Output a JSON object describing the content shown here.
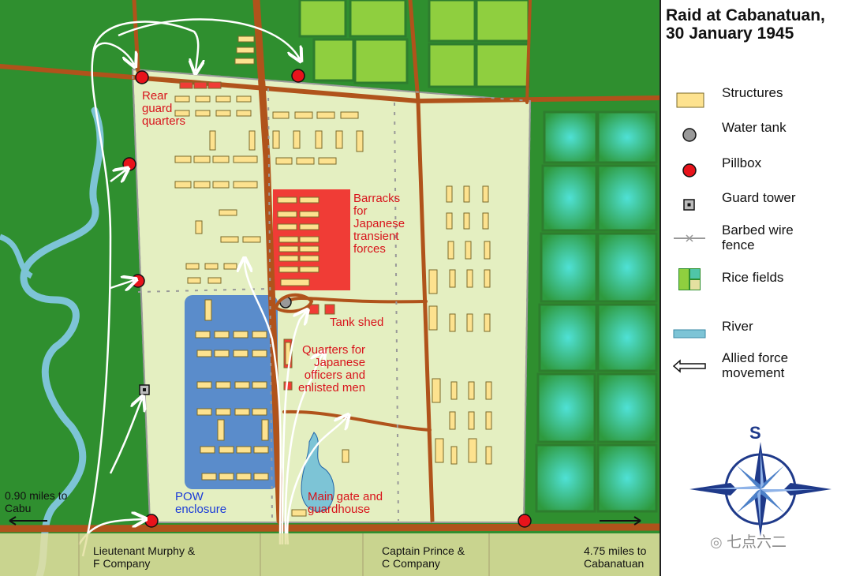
{
  "title": "Raid at Cabanatuan,\n30 January 1945",
  "legend": [
    {
      "key": "structures",
      "label": "Structures"
    },
    {
      "key": "water_tank",
      "label": "Water tank"
    },
    {
      "key": "pillbox",
      "label": "Pillbox"
    },
    {
      "key": "guard_tower",
      "label": "Guard tower"
    },
    {
      "key": "barbed_wire",
      "label": "Barbed wire\nfence"
    },
    {
      "key": "rice_fields",
      "label": "Rice fields"
    },
    {
      "key": "river",
      "label": "River"
    },
    {
      "key": "allied_movement",
      "label": "Allied force\nmovement"
    }
  ],
  "map_labels": {
    "rear_guard": "Rear\nguard\nquarters",
    "barracks": "Barracks\nfor\nJapanese\ntransient\nforces",
    "tank_shed": "Tank shed",
    "officers": "Quarters for\nJapanese\nofficers and\nenlisted men",
    "pow": "POW\nenclosure",
    "main_gate": "Main gate and\nguardhouse",
    "cabu": "0.90 miles to\nCabu",
    "cabanatuan": "4.75 miles to\nCabanatuan",
    "murphy": "Lieutenant Murphy &\nF Company",
    "prince": "Captain Prince &\nC Company"
  },
  "compass_letter": "S",
  "watermark": "七点六二",
  "colors": {
    "grass": "#2f8f2f",
    "camp": "#e4efc1",
    "structure": "#fde28f",
    "barracks": "#f03c36",
    "pow": "#5a8ccb",
    "road": "#b0531b",
    "river": "#7dc4d6",
    "pillbox": "#e8131b"
  }
}
